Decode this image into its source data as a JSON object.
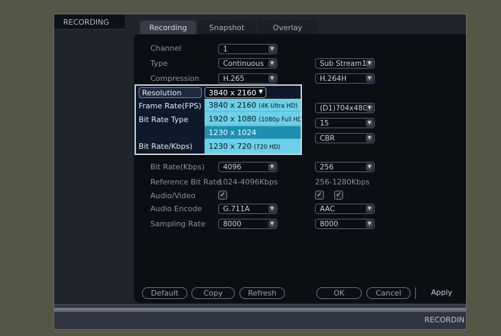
{
  "header": {
    "title": "RECORDING"
  },
  "tabs": [
    {
      "label": "Recording",
      "active": true
    },
    {
      "label": "Snapshot",
      "active": false
    },
    {
      "label": "Overlay",
      "active": false
    }
  ],
  "form": {
    "channel": {
      "label": "Channel",
      "value": "1"
    },
    "type": {
      "label": "Type",
      "main_value": "Continuous",
      "sub_value": "Sub Stream1"
    },
    "compression": {
      "label": "Compression",
      "main_value": "H.265",
      "sub_value": "H.264H"
    },
    "sub_resolution_value": "(D1)704x480",
    "sub_fps_value": "15",
    "sub_bitrate_type_value": "CBR",
    "bitrate": {
      "label": "Bit Rate(Kbps)",
      "main_value": "4096",
      "sub_value": "256"
    },
    "reference_bitrate": {
      "label": "Reference Bit Rate",
      "main_value": "1024-4096Kbps",
      "sub_value": "256-1280Kbps"
    },
    "audio_video": {
      "label": "Audio/Video",
      "main_checked": true,
      "sub_checked_1": true,
      "sub_checked_2": true
    },
    "audio_encode": {
      "label": "Audio Encode",
      "main_value": "G.711A",
      "sub_value": "AAC"
    },
    "sampling_rate": {
      "label": "Sampling Rate",
      "main_value": "8000",
      "sub_value": "8000"
    }
  },
  "overlay": {
    "resolution_label": "Resolution",
    "resolution_value": "3840 x 2160",
    "fps_label": "Frame Rate(FPS)",
    "bitrate_type_label": "Bit Rate Type",
    "bitrate_label": "Bit Rate/Kbps)",
    "options": [
      {
        "main": "3840 x 2160",
        "sub": "(4K Ultra HD)"
      },
      {
        "main": "1920 x 1080",
        "sub": "(1080p Full HD"
      },
      {
        "main": "1230 x 1024",
        "sub": ""
      },
      {
        "main": "1230 x 720",
        "sub": "(720 HD)"
      }
    ]
  },
  "buttons": {
    "default": "Default",
    "copy": "Copy",
    "refresh": "Refresh",
    "ok": "OK",
    "cancel": "Cancel",
    "apply": "Apply"
  },
  "footer": {
    "label": "RECORDIN"
  },
  "icons": {
    "dropdown_arrow": "chevron-down-icon",
    "check": "check-icon"
  },
  "colors": {
    "highlight": "#6cd0e6",
    "selected": "#1d8fb0"
  }
}
